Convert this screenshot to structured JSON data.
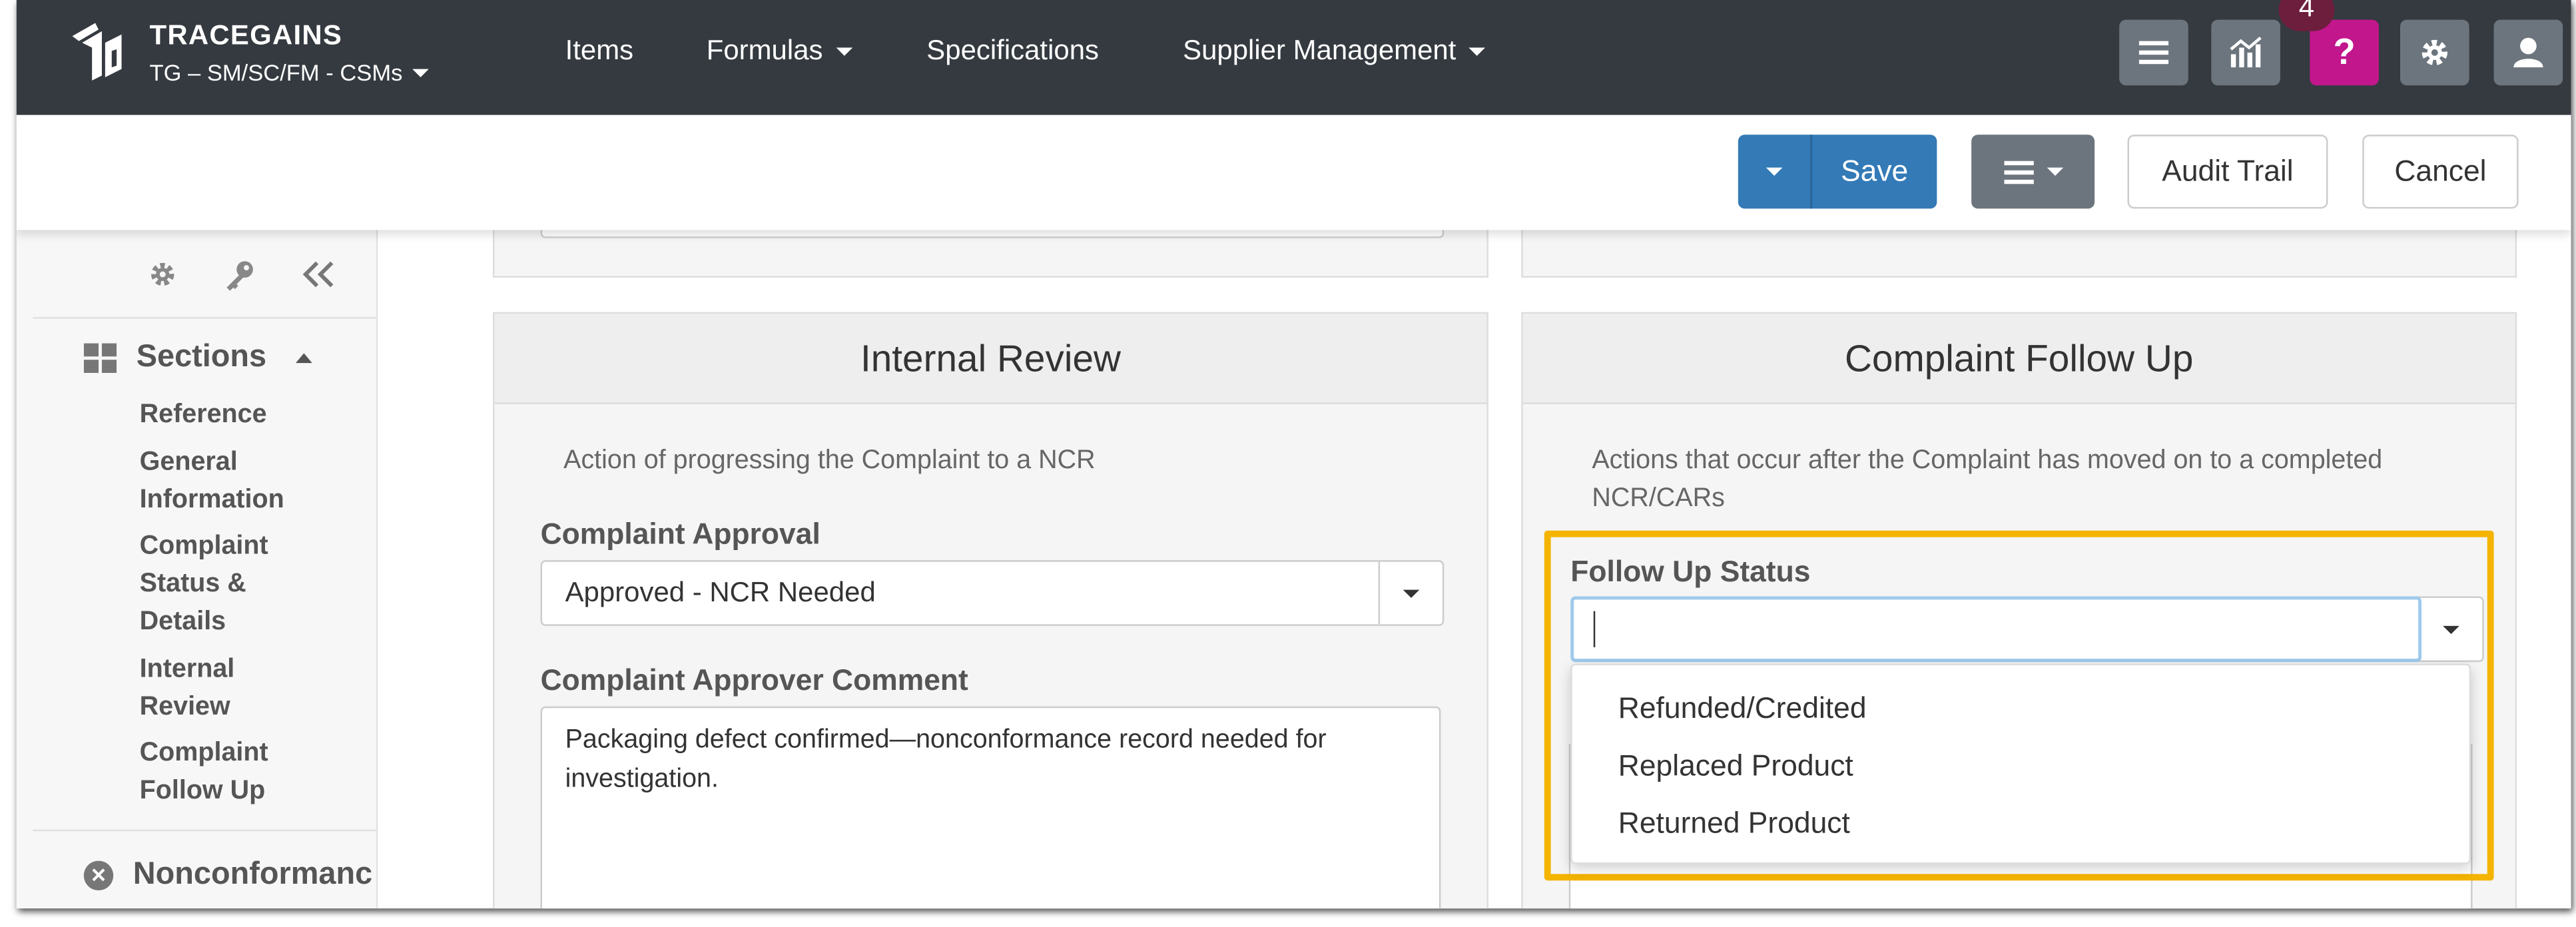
{
  "brand": {
    "name": "TRACEGAINS",
    "context": "TG – SM/SC/FM - CSMs"
  },
  "nav": {
    "items": [
      "Items",
      "Formulas",
      "Specifications",
      "Supplier Management"
    ],
    "help_badge": "4",
    "help_label": "?"
  },
  "toolbar": {
    "save_label": "Save",
    "audit_trail_label": "Audit Trail",
    "cancel_label": "Cancel"
  },
  "sidebar": {
    "sections_label": "Sections",
    "items": [
      "Reference",
      "General Information",
      "Complaint Status & Details",
      "Internal Review",
      "Complaint Follow Up"
    ],
    "next_section_label": "Nonconformanc"
  },
  "internal_review": {
    "title": "Internal Review",
    "description": "Action of progressing the Complaint to a NCR",
    "approval_label": "Complaint Approval",
    "approval_value": "Approved - NCR Needed",
    "comment_label": "Complaint Approver Comment",
    "comment_value": "Packaging defect confirmed—nonconformance record needed for investigation."
  },
  "follow_up": {
    "title": "Complaint Follow Up",
    "description": "Actions that occur after the Complaint has moved on to a completed NCR/CARs",
    "status_label": "Follow Up Status",
    "status_value": "",
    "options": [
      "Refunded/Credited",
      "Replaced Product",
      "Returned Product"
    ]
  },
  "colors": {
    "nav_bg": "#343a40",
    "primary": "#337ab7",
    "help": "#c2168d",
    "highlight": "#f4b400"
  }
}
